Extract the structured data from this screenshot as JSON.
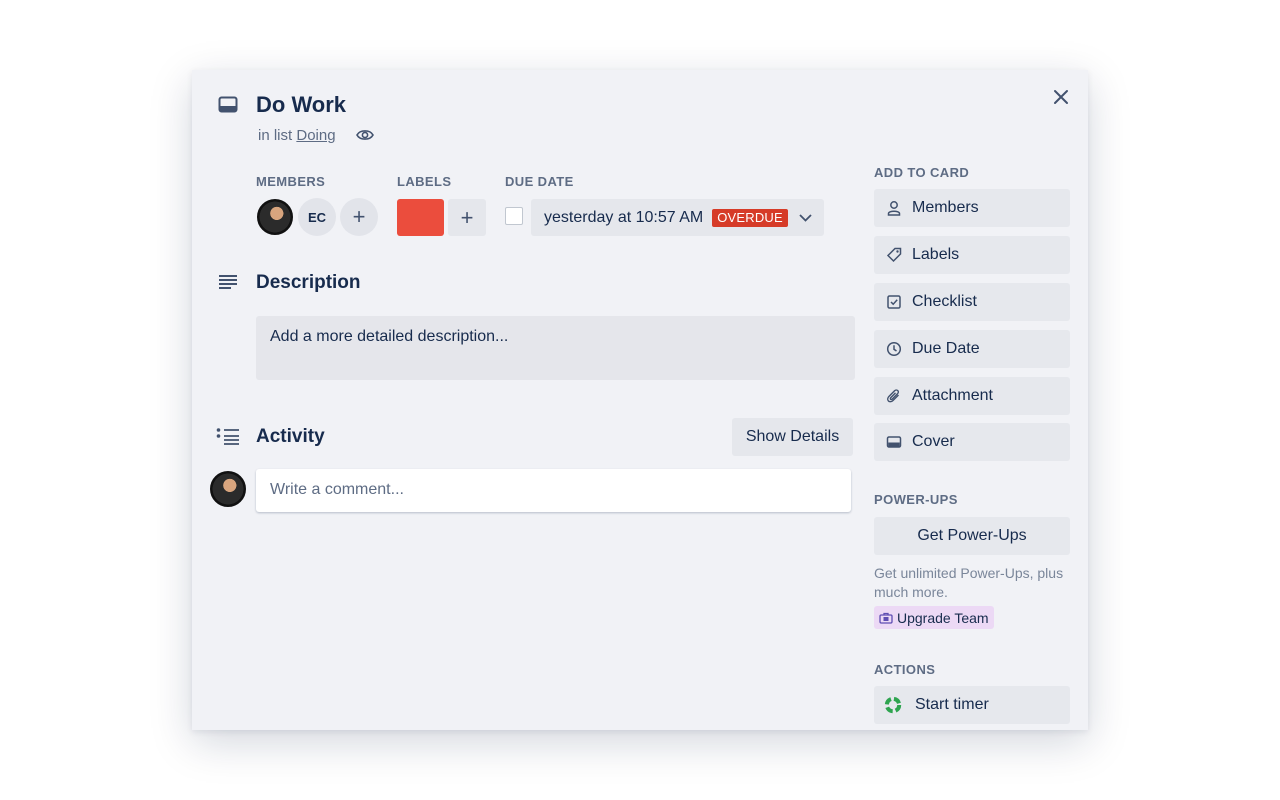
{
  "card": {
    "title": "Do Work",
    "list_prefix": "in list",
    "list_name": "Doing",
    "icons": {
      "card": "card-icon",
      "close": "close-icon",
      "watch": "eye-icon"
    }
  },
  "members": {
    "label": "MEMBERS",
    "initials": "EC",
    "add": "+"
  },
  "labels": {
    "label": "LABELS",
    "color": "#eb4d3d",
    "add": "+"
  },
  "due_date": {
    "label": "DUE DATE",
    "value": "yesterday at 10:57 AM",
    "status": "OVERDUE",
    "status_color": "#d63b28",
    "completed": false
  },
  "description": {
    "heading": "Description",
    "placeholder": "Add a more detailed description..."
  },
  "activity": {
    "heading": "Activity",
    "show_details": "Show Details",
    "comment_placeholder": "Write a comment..."
  },
  "sidebar": {
    "add_to_card_label": "ADD TO CARD",
    "add_items": [
      {
        "label": "Members",
        "icon": "person-icon"
      },
      {
        "label": "Labels",
        "icon": "tag-icon"
      },
      {
        "label": "Checklist",
        "icon": "checklist-icon"
      },
      {
        "label": "Due Date",
        "icon": "clock-icon"
      },
      {
        "label": "Attachment",
        "icon": "paperclip-icon"
      },
      {
        "label": "Cover",
        "icon": "cover-icon"
      }
    ],
    "powerups_label": "POWER-UPS",
    "get_powerups": "Get Power-Ups",
    "powerups_text": "Get unlimited Power-Ups, plus much more.",
    "upgrade_team": "Upgrade Team",
    "actions_label": "ACTIONS",
    "start_timer": "Start timer"
  },
  "colors": {
    "background": "#f1f2f6",
    "button": "#e6e8ed",
    "text": "#172b4d",
    "muted": "#5e6c84",
    "upgrade_bg": "#ecd9f5",
    "timer_green": "#2ea44f"
  }
}
